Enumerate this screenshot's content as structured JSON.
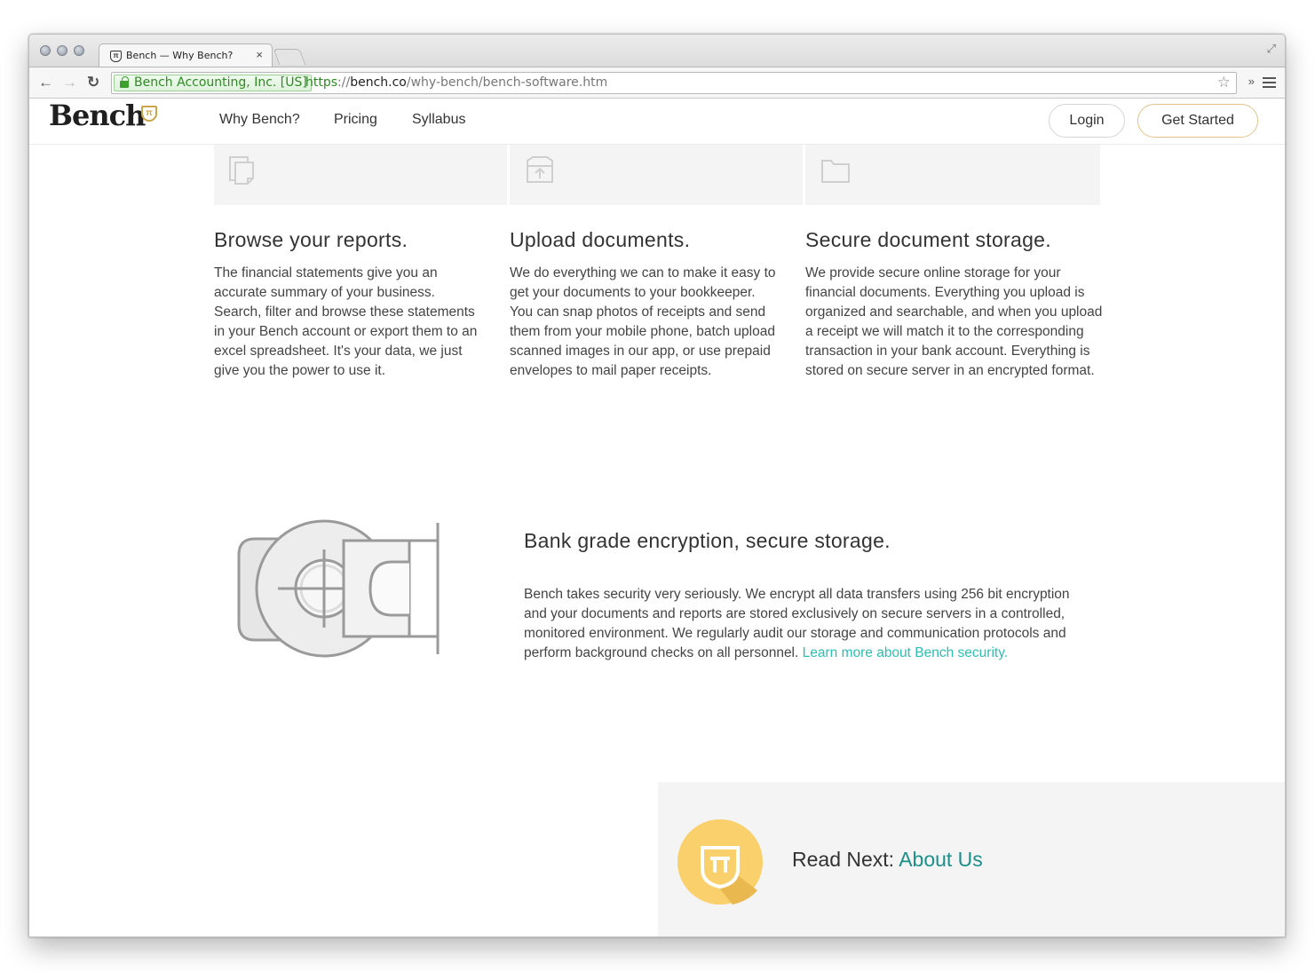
{
  "browser": {
    "tab_title": "Bench — Why Bench?",
    "tab_close": "×",
    "ev_label": "Bench Accounting, Inc. [US]",
    "url_scheme": "https",
    "url_sep": "://",
    "url_host": "bench.co",
    "url_path": "/why-bench/bench-software.htm",
    "back_glyph": "←",
    "forward_glyph": "→",
    "reload_glyph": "↻",
    "star_glyph": "☆",
    "ext_glyph": "»",
    "fullscreen_glyph": "⤢"
  },
  "header": {
    "logo_text": "Bench",
    "logo_mark": "π",
    "nav": [
      "Why Bench?",
      "Pricing",
      "Syllabus"
    ],
    "login_label": "Login",
    "get_started_label": "Get Started"
  },
  "features": [
    {
      "icon": "documents-icon",
      "title": "Browse your reports.",
      "body": "The financial statements give you an accurate summary of your business. Search, filter and browse these statements in your Bench account or export them to an excel spreadsheet. It's your data, we just give you the power to use it."
    },
    {
      "icon": "upload-icon",
      "title": "Upload documents.",
      "body": "We do everything we can to make it easy to get your documents to your bookkeeper. You can snap photos of receipts and send them from your mobile phone, batch upload scanned images in our app, or use prepaid envelopes to mail paper receipts."
    },
    {
      "icon": "folder-icon",
      "title": "Secure document storage.",
      "body": "We provide secure online storage for your financial documents. Everything you upload is organized and searchable, and when you upload a receipt we will match it to the corresponding transaction in your bank account. Everything is stored on secure server in an encrypted format."
    }
  ],
  "security": {
    "title": "Bank grade encryption, secure storage.",
    "body": "Bench takes security very seriously. We encrypt all data transfers using 256 bit encryption and your documents and reports are stored exclusively on secure servers in a controlled, monitored environment. We regularly audit our storage and communication protocols and perform background checks on all personnel.",
    "link_text": "Learn more about Bench security."
  },
  "read_next": {
    "prefix": "Read Next: ",
    "link_text": "About Us"
  },
  "colors": {
    "accent_gold": "#c9a547",
    "link_teal": "#2bbfb3",
    "read_next_teal": "#1b8f8a",
    "badge_yellow": "#f9d06b"
  }
}
